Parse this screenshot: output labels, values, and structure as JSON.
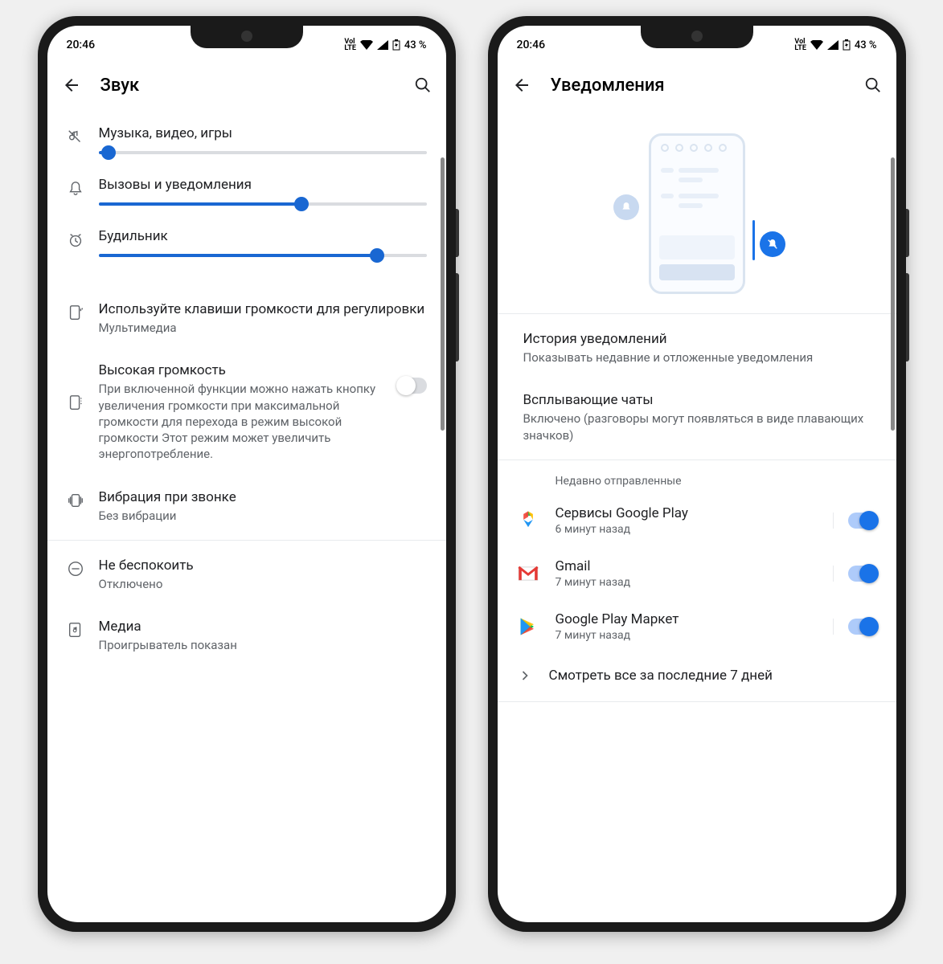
{
  "status": {
    "time": "20:46",
    "volte": "Vol\nLTE",
    "battery": "43 %"
  },
  "left_phone": {
    "title": "Звук",
    "sliders": {
      "media": {
        "label": "Музыка, видео, игры",
        "value": 3
      },
      "calls": {
        "label": "Вызовы и уведомления",
        "value": 62
      },
      "alarm": {
        "label": "Будильник",
        "value": 85
      }
    },
    "volume_keys": {
      "title": "Используйте клавиши громкости для регулировки",
      "sub": "Мультимедиа"
    },
    "high_volume": {
      "title": "Высокая громкость",
      "sub": "При включенной функции можно нажать кнопку увеличения громкости при максимальной громкости для перехода в режим высокой громкости Этот режим может увеличить энергопотребление.",
      "enabled": false
    },
    "vibration": {
      "title": "Вибрация при звонке",
      "sub": "Без вибрации"
    },
    "dnd": {
      "title": "Не беспокоить",
      "sub": "Отключено"
    },
    "media_player": {
      "title": "Медиа",
      "sub": "Проигрыватель показан"
    }
  },
  "right_phone": {
    "title": "Уведомления",
    "history": {
      "title": "История уведомлений",
      "sub": "Показывать недавние и отложенные уведомления"
    },
    "bubbles": {
      "title": "Всплывающие чаты",
      "sub": "Включено (разговоры могут появляться в виде плавающих значков)"
    },
    "recent_header": "Недавно отправленные",
    "apps": {
      "gplay_services": {
        "name": "Сервисы Google Play",
        "time": "6 минут назад",
        "enabled": true
      },
      "gmail": {
        "name": "Gmail",
        "time": "7 минут назад",
        "enabled": true
      },
      "play_market": {
        "name": "Google Play Маркет",
        "time": "7 минут назад",
        "enabled": true
      }
    },
    "see_all": "Смотреть все за последние 7 дней"
  }
}
